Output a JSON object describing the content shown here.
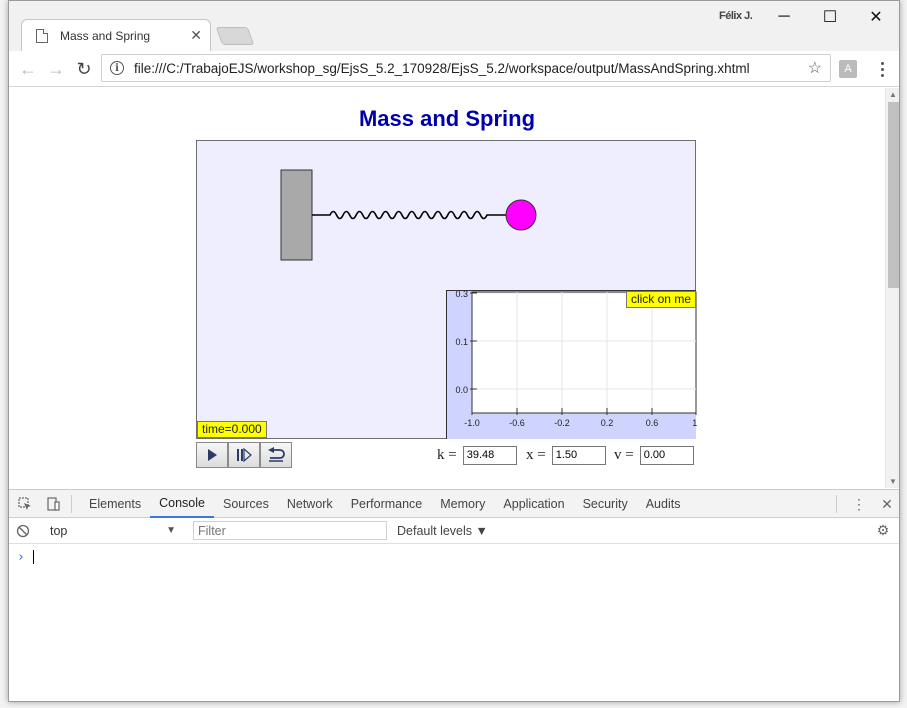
{
  "window": {
    "profile_name": "Félix J.",
    "minimize_glyph": "─",
    "maximize_glyph": "☐",
    "close_glyph": "✕"
  },
  "tab": {
    "title": "Mass and Spring",
    "close_glyph": "✕"
  },
  "toolbar": {
    "back_glyph": "←",
    "forward_glyph": "→",
    "reload_glyph": "↻",
    "info_glyph": "i",
    "url": "file:///C:/TrabajoEJS/workshop_sg/EjsS_5.2_170928/EjsS_5.2/workspace/output/MassAndSpring.xhtml",
    "star_glyph": "☆",
    "ext_glyph": "A"
  },
  "simulation": {
    "title": "Mass and Spring",
    "time_label": "time=0.000",
    "plot": {
      "click_label": "click on me",
      "x_ticks": [
        "-1.0",
        "-0.6",
        "-0.2",
        "0.2",
        "0.6",
        "1."
      ],
      "y_ticks": [
        "0.3",
        "0.1",
        "0.0"
      ]
    },
    "controls": {
      "play": "play-icon",
      "step": "step-icon",
      "reset": "reset-icon"
    },
    "params": {
      "k_label": "k =",
      "k_value": "39.48",
      "x_label": "x =",
      "x_value": "1.50",
      "v_label": "v =",
      "v_value": "0.00"
    },
    "colors": {
      "title": "#0000a8",
      "background": "#eeeeff",
      "ball": "#ff00ff",
      "wall": "#a9a9a9",
      "label_bg": "#ffff00"
    }
  },
  "devtools": {
    "tabs": [
      "Elements",
      "Console",
      "Sources",
      "Network",
      "Performance",
      "Memory",
      "Application",
      "Security",
      "Audits"
    ],
    "active_tab": "Console",
    "context": "top",
    "filter_placeholder": "Filter",
    "levels": "Default levels ▼",
    "prompt": "›"
  }
}
